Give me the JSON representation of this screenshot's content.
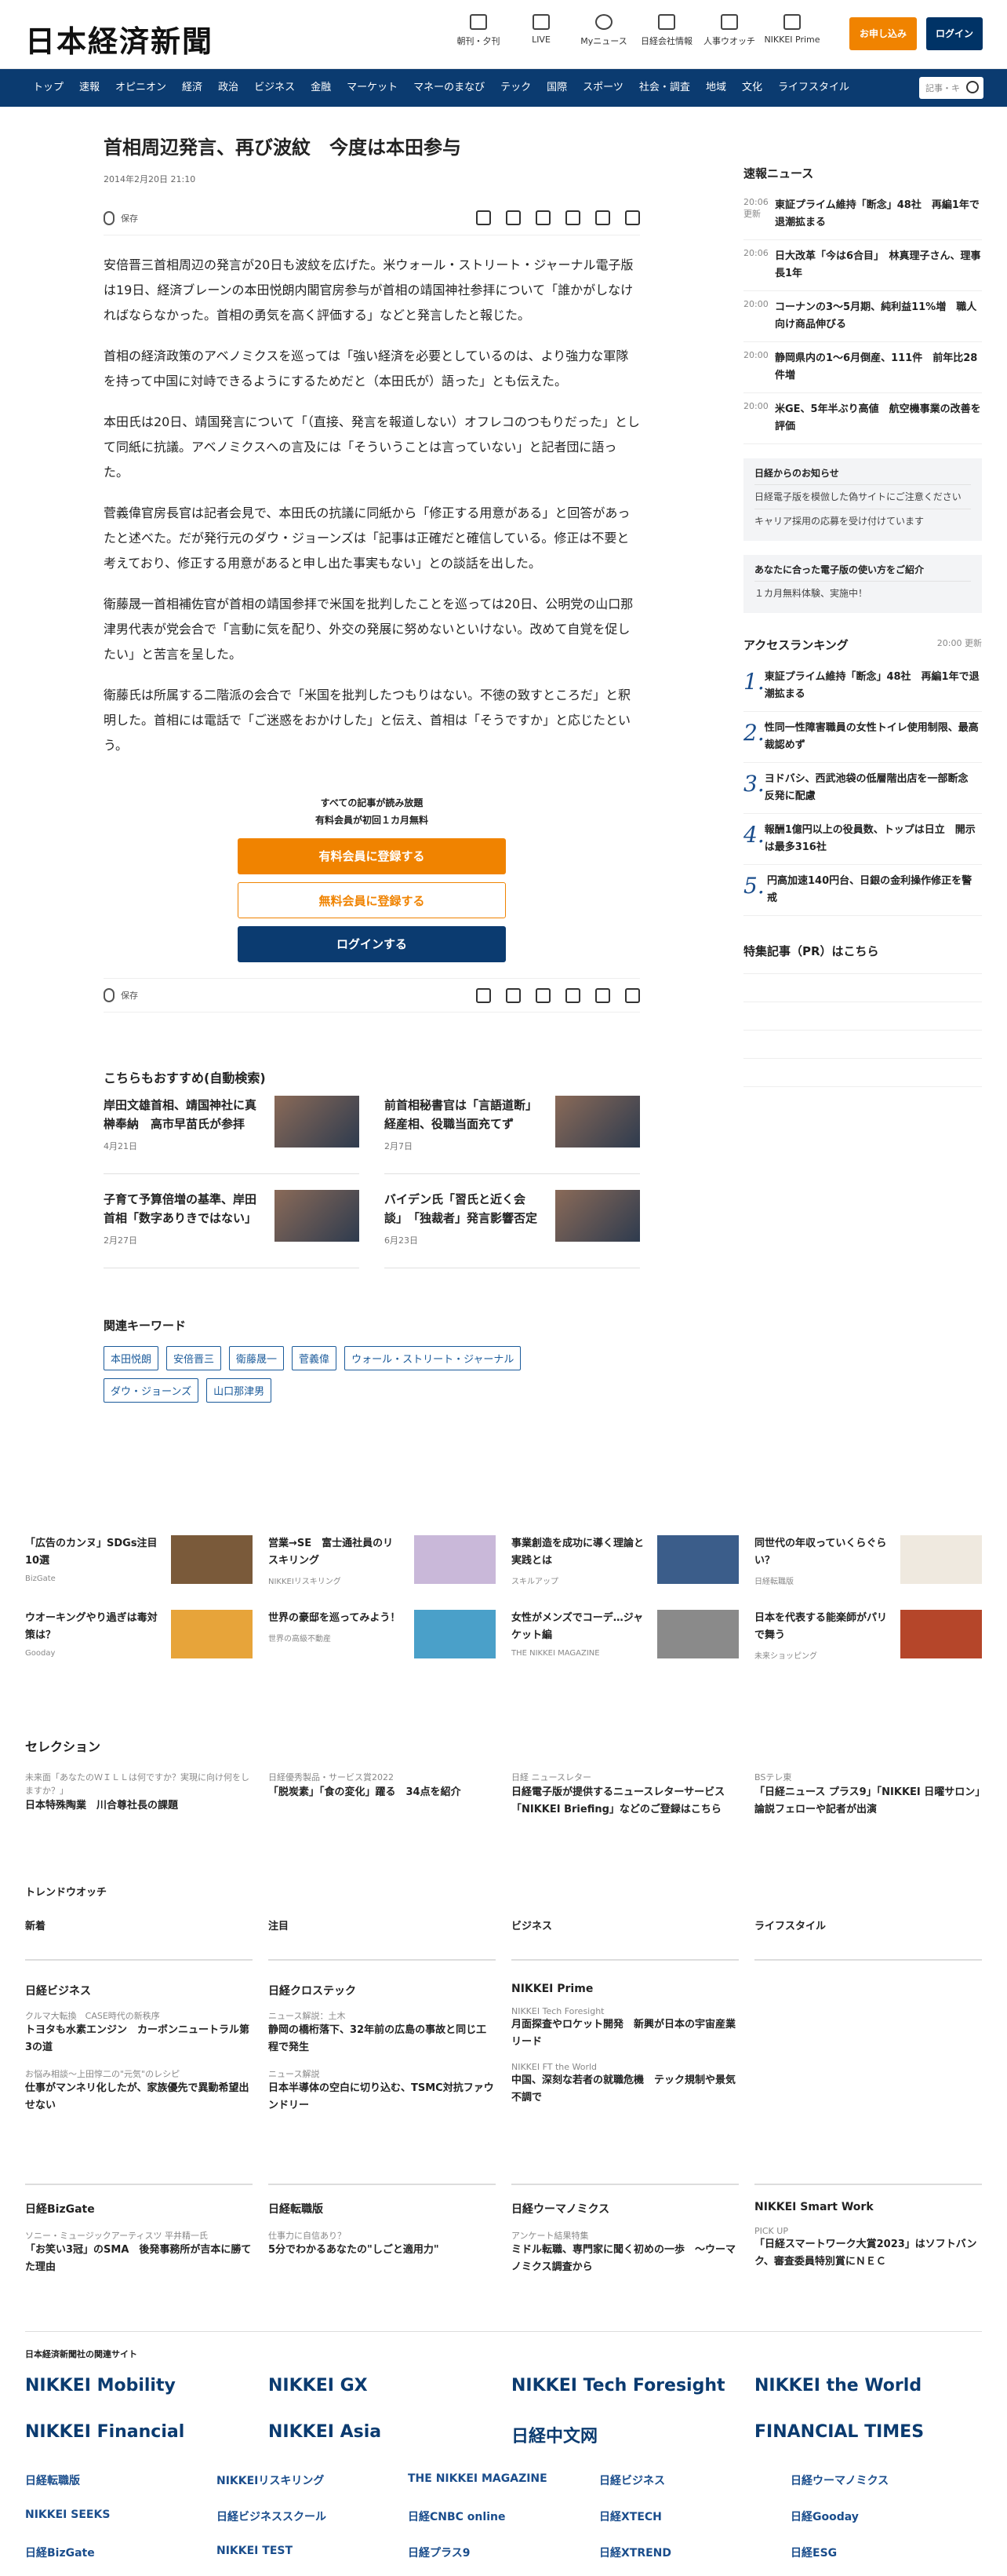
{
  "header": {
    "logo": "日本経済新聞",
    "nav": [
      "朝刊・夕刊",
      "LIVE",
      "Myニュース",
      "日経会社情報",
      "人事ウオッチ",
      "NIKKEI Prime"
    ],
    "subscribe": "お申し込み",
    "login": "ログイン"
  },
  "gnav": {
    "items": [
      "トップ",
      "速報",
      "オピニオン",
      "経済",
      "政治",
      "ビジネス",
      "金融",
      "マーケット",
      "マネーのまなび",
      "テック",
      "国際",
      "スポーツ",
      "社会・調査",
      "地域",
      "文化",
      "ライフスタイル"
    ],
    "search_placeholder": "記事・キ"
  },
  "article": {
    "title": "首相周辺発言、再び波紋　今度は本田参与",
    "date": "2014年2月20日 21:10",
    "save": "保存",
    "paragraphs": [
      "安倍晋三首相周辺の発言が20日も波紋を広げた。米ウォール・ストリート・ジャーナル電子版は19日、経済ブレーンの本田悦朗内閣官房参与が首相の靖国神社参拝について「誰かがしなければならなかった。首相の勇気を高く評価する」などと発言したと報じた。",
      "首相の経済政策のアベノミクスを巡っては「強い経済を必要としているのは、より強力な軍隊を持って中国に対峙できるようにするためだと（本田氏が）語った」とも伝えた。",
      "本田氏は20日、靖国発言について「（直接、発言を報道しない）オフレコのつもりだった」として同紙に抗議。アベノミクスへの言及には「そういうことは言っていない」と記者団に語った。",
      "菅義偉官房長官は記者会見で、本田氏の抗議に同紙から「修正する用意がある」と回答があったと述べた。だが発行元のダウ・ジョーンズは「記事は正確だと確信している。修正は不要と考えており、修正する用意があると申し出た事実もない」との談話を出した。",
      "衛藤晟一首相補佐官が首相の靖国参拝で米国を批判したことを巡っては20日、公明党の山口那津男代表が党会合で「言動に気を配り、外交の発展に努めないといけない。改めて自覚を促したい」と苦言を呈した。",
      "衛藤氏は所属する二階派の会合で「米国を批判したつもりはない。不徳の致すところだ」と釈明した。首相には電話で「ご迷惑をおかけした」と伝え、首相は「そうですか」と応じたという。"
    ]
  },
  "paywall": {
    "line1": "すべての記事が読み放題",
    "line2": "有料会員が初回１カ月無料",
    "paid": "有料会員に登録する",
    "free": "無料会員に登録する",
    "login": "ログインする"
  },
  "recommend": {
    "title": "こちらもおすすめ(自動検索)",
    "items": [
      {
        "title": "岸田文雄首相、靖国神社に真榊奉納　高市早苗氏が参拝",
        "date": "4月21日"
      },
      {
        "title": "前首相秘書官は「言語道断」　経産相、役職当面充てず",
        "date": "2月7日"
      },
      {
        "title": "子育て予算倍増の基準、岸田首相「数字ありきではない」",
        "date": "2月27日"
      },
      {
        "title": "バイデン氏「習氏と近く会談」　「独裁者」発言影響否定",
        "date": "6月23日"
      }
    ]
  },
  "keywords": {
    "title": "関連キーワード",
    "items": [
      "本田悦朗",
      "安倍晋三",
      "衛藤晟一",
      "菅義偉",
      "ウォール・ストリート・ジャーナル",
      "ダウ・ジョーンズ",
      "山口那津男"
    ]
  },
  "side": {
    "news_title": "速報ニュース",
    "news": [
      {
        "time": "20:06",
        "tag": "更新",
        "text": "東証プライム維持「断念」48社　再編1年で退潮拡まる"
      },
      {
        "time": "20:06",
        "tag": "",
        "text": "日大改革「今は6合目」　林真理子さん、理事長1年"
      },
      {
        "time": "20:00",
        "tag": "",
        "text": "コーナンの3～5月期、純利益11%増　職人向け商品伸びる"
      },
      {
        "time": "20:00",
        "tag": "",
        "text": "静岡県内の1～6月倒産、111件　前年比28件増"
      },
      {
        "time": "20:00",
        "tag": "",
        "text": "米GE、5年半ぶり高値　航空機事業の改善を評価"
      }
    ],
    "notice_title": "日経からのお知らせ",
    "notices": [
      "日経電子版を模倣した偽サイトにご注意ください",
      "キャリア採用の応募を受け付けています"
    ],
    "guide_title": "あなたに合った電子版の使い方をご紹介",
    "guide": [
      "１カ月無料体験、実施中！"
    ],
    "rank_title": "アクセスランキング",
    "rank_time": "20:00 更新",
    "ranking": [
      "東証プライム維持「断念」48社　再編1年で退潮拡まる",
      "性同一性障害職員の女性トイレ使用制限、最高裁認めず",
      "ヨドバシ、西武池袋の低層階出店を一部断念　反発に配慮",
      "報酬1億円以上の役員数、トップは日立　開示は最多316社",
      "円高加速140円台、日銀の金利操作修正を警戒"
    ],
    "pr": "特集記事（PR）はこちら"
  },
  "ads": [
    {
      "title": "「広告のカンヌ」SDGs注目10選",
      "src": "BizGate"
    },
    {
      "title": "営業→SE　富士通社員のリスキリング",
      "src": "NIKKEIリスキリング"
    },
    {
      "title": "事業創造を成功に導く理論と実践とは",
      "src": "スキルアップ"
    },
    {
      "title": "同世代の年収っていくらぐらい？",
      "src": "日経転職版"
    },
    {
      "title": "ウオーキングやり過ぎは毒対策は？",
      "src": "Gooday"
    },
    {
      "title": "世界の豪邸を巡ってみよう！",
      "src": "世界の高級不動産"
    },
    {
      "title": "女性がメンズでコーデ…ジャケット編",
      "src": "THE NIKKEI MAGAZINE"
    },
    {
      "title": "日本を代表する能楽師がパリで舞う",
      "src": "未来ショッピング"
    }
  ],
  "selection": {
    "title": "セレクション",
    "items": [
      {
        "label": "未来面「あなたのＷＩＬＬは何ですか？実現に向け何をしますか？」",
        "text": "日本特殊陶業　川合尊社長の課題"
      },
      {
        "label": "日経優秀製品・サービス賞2022",
        "text": "「脱炭素」「食の変化」躍る　34点を紹介"
      },
      {
        "label": "日経 ニュースレター",
        "text": "日経電子版が提供するニュースレターサービス「NIKKEI Briefing」などのご登録はこちら"
      },
      {
        "label": "BSテレ東",
        "text": "「日経ニュース プラス9」「NIKKEI 日曜サロン」論説フェローや記者が出演"
      }
    ]
  },
  "trend": {
    "title": "トレンドウオッチ",
    "cols": [
      "新着",
      "注目",
      "ビジネス",
      "ライフスタイル"
    ]
  },
  "media1": [
    {
      "h": "日経ビジネス",
      "a": [
        {
          "l": "クルマ大転換　CASE時代の新秩序",
          "t": "トヨタも水素エンジン　カーボンニュートラル第3の道"
        },
        {
          "l": "お悩み相談～上田惇二の\"元気\"のレシピ",
          "t": "仕事がマンネリ化したが、家族優先で異動希望出せない"
        }
      ]
    },
    {
      "h": "日経クロステック",
      "a": [
        {
          "l": "ニュース解説：土木",
          "t": "静岡の橋桁落下、32年前の広島の事故と同じ工程で発生"
        },
        {
          "l": "ニュース解説",
          "t": "日本半導体の空白に切り込む、TSMC対抗ファウンドリー"
        }
      ]
    },
    {
      "h": "NIKKEI Prime",
      "a": [
        {
          "l": "NIKKEI Tech Foresight",
          "t": "月面探査やロケット開発　新興が日本の宇宙産業リード"
        },
        {
          "l": "NIKKEI FT the World",
          "t": "中国、深刻な若者の就職危機　テック規制や景気不調で"
        }
      ]
    }
  ],
  "media2": [
    {
      "h": "日経BizGate",
      "l": "ソニー・ミュージックアーティスツ 平井精一氏",
      "t": "「お笑い3冠」のSMA　後発事務所が吉本に勝てた理由"
    },
    {
      "h": "日経転職版",
      "l": "仕事力に自信あり？",
      "t": "5分でわかるあなたの\"しごと適用力\""
    },
    {
      "h": "日経ウーマノミクス",
      "l": "アンケート結果特集",
      "t": "ミドル転職、専門家に聞く初めの一歩　～ウーマノミクス調査から"
    },
    {
      "h": "NIKKEI Smart Work",
      "l": "PICK UP",
      "t": "「日経スマートワーク大賞2023」はソフトバンク、審査委員特別賞にＮＥＣ"
    }
  ],
  "related": {
    "title": "日本経済新聞社の関連サイト",
    "logos": [
      "NIKKEI Mobility",
      "NIKKEI GX",
      "NIKKEI Tech Foresight",
      "NIKKEI the World",
      "NIKKEI Financial",
      "NIKKEI Asia",
      "日経中文网",
      "FINANCIAL TIMES"
    ],
    "sub": [
      "日経転職版",
      "NIKKEIリスキリング",
      "THE NIKKEI MAGAZINE",
      "日経ビジネス",
      "日経ウーマノミクス",
      "NIKKEI SEEKS",
      "日経ビジネススクール",
      "日経CNBC online",
      "日経XTECH",
      "日経Gooday",
      "日経BizGate",
      "NIKKEI TEST",
      "日経プラス9",
      "日経XTREND",
      "日経ESG"
    ]
  }
}
